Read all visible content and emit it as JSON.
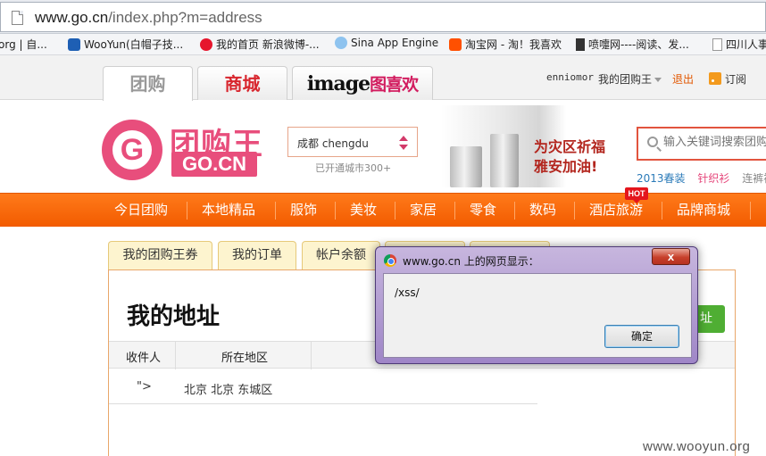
{
  "browser": {
    "url_host": "www.go.cn",
    "url_path": "/index.php?m=address",
    "bookmarks": [
      {
        "label": "org | 自..."
      },
      {
        "label": "WooYun(白帽子技..."
      },
      {
        "label": "我的首页 新浪微博-..."
      },
      {
        "label": "Sina App Engine"
      },
      {
        "label": "淘宝网 - 淘！我喜欢"
      },
      {
        "label": "喷嚏网----阅读、发..."
      },
      {
        "label": "四川人事"
      }
    ]
  },
  "channels": {
    "tuangou": "团购",
    "shangcheng": "商城",
    "image_logo": "image",
    "image_cn": "图喜欢"
  },
  "userbar": {
    "username": "enniomor",
    "my_account": "我的团购王",
    "logout": "退出",
    "subscribe": "订阅"
  },
  "header": {
    "logo_letter": "G",
    "logo_cn": "团购王",
    "logo_en": "GO.CN",
    "city": "成都 chengdu",
    "city_count": "已开通城市300+",
    "banner_line1": "为灾区祈福",
    "banner_line2": "雅安加油!",
    "search_placeholder": "输入关键词搜索团购",
    "hot_words": [
      "2013春装",
      "针织衫",
      "连裤袜"
    ]
  },
  "nav": {
    "items": [
      "今日团购",
      "本地精品",
      "服饰",
      "美妆",
      "家居",
      "零食",
      "数码",
      "酒店旅游",
      "品牌商城"
    ],
    "hot_badge": "HOT"
  },
  "account": {
    "tabs": [
      "我的团购王券",
      "我的订单",
      "帐户余额",
      "",
      ""
    ],
    "title": "我的地址",
    "add_button": "址",
    "columns": [
      "收件人",
      "所在地区"
    ],
    "rows": [
      {
        "recipient": "\">",
        "region": "北京 北京 东城区"
      }
    ]
  },
  "dialog": {
    "title": "www.go.cn 上的网页显示：",
    "message": "/xss/",
    "close": "x",
    "ok": "确定"
  },
  "watermark": "www.wooyun.org"
}
